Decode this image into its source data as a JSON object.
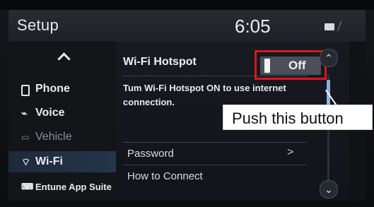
{
  "topbar": {
    "title": "Setup",
    "time": "6:05"
  },
  "sidebar": {
    "items": [
      {
        "label": "Phone",
        "icon": "phone-icon"
      },
      {
        "label": "Voice",
        "icon": "voice-icon"
      },
      {
        "label": "Vehicle",
        "icon": "vehicle-icon"
      },
      {
        "label": "Wi-Fi",
        "icon": "wifi-icon",
        "selected": true
      },
      {
        "label": "Entune App Suite",
        "icon": "apps-icon"
      }
    ]
  },
  "content": {
    "hotspot": {
      "label": "Wi-Fi Hotspot",
      "toggle_text": "Off"
    },
    "description": "Tum Wi-Fi Hotspot ON to use internet connection.",
    "rows": [
      {
        "label": "Password",
        "chevron": ">"
      },
      {
        "label": "How to Connect"
      }
    ]
  },
  "annotation": {
    "callout_text": "Push this button",
    "highlight_color": "#e1141b"
  }
}
